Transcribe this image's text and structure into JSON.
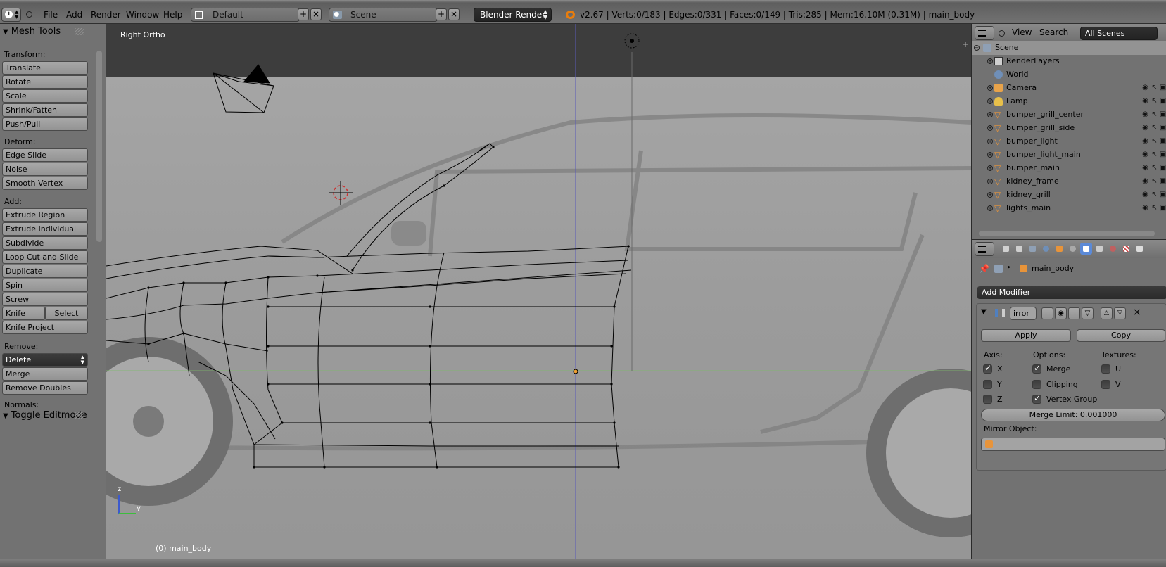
{
  "topbar": {
    "menus": [
      "File",
      "Add",
      "Render",
      "Window",
      "Help"
    ],
    "layout": "Default",
    "scene": "Scene",
    "engine": "Blender Render",
    "stats": "v2.67 | Verts:0/183 | Edges:0/331 | Faces:0/149 | Tris:285 | Mem:16.10M (0.31M) | main_body"
  },
  "toolshelf": {
    "title": "Mesh Tools",
    "transform_label": "Transform:",
    "transform": [
      "Translate",
      "Rotate",
      "Scale",
      "Shrink/Fatten",
      "Push/Pull"
    ],
    "deform_label": "Deform:",
    "deform": [
      "Edge Slide",
      "Noise",
      "Smooth Vertex"
    ],
    "add_label": "Add:",
    "add": [
      "Extrude Region",
      "Extrude Individual",
      "Subdivide",
      "Loop Cut and Slide",
      "Duplicate",
      "Spin",
      "Screw"
    ],
    "knife": "Knife",
    "select": "Select",
    "knife_project": "Knife Project",
    "remove_label": "Remove:",
    "delete": "Delete",
    "remove": [
      "Merge",
      "Remove Doubles"
    ],
    "normals_label": "Normals:",
    "toggle_editmode": "Toggle Editmode"
  },
  "viewport": {
    "view_name": "Right Ortho",
    "object_label": "(0) main_body",
    "axis_z": "z",
    "axis_y": "y"
  },
  "outliner": {
    "menus": [
      "View",
      "Search"
    ],
    "filter": "All Scenes",
    "rows": [
      {
        "name": "Scene",
        "icon": "scene-icon",
        "color": "#8fa0b5"
      },
      {
        "name": "RenderLayers",
        "icon": "render-layers-icon",
        "color": "#cfcfcf"
      },
      {
        "name": "World",
        "icon": "world-icon",
        "color": "#6f8fb8"
      },
      {
        "name": "Camera",
        "icon": "camera-icon",
        "color": "#e8a34a"
      },
      {
        "name": "Lamp",
        "icon": "lamp-icon",
        "color": "#e8c04a"
      },
      {
        "name": "bumper_grill_center",
        "icon": "mesh-icon",
        "color": "#e8943a"
      },
      {
        "name": "bumper_grill_side",
        "icon": "mesh-icon",
        "color": "#e8943a"
      },
      {
        "name": "bumper_light",
        "icon": "mesh-icon",
        "color": "#e8943a"
      },
      {
        "name": "bumper_light_main",
        "icon": "mesh-icon",
        "color": "#e8943a"
      },
      {
        "name": "bumper_main",
        "icon": "mesh-icon",
        "color": "#e8943a"
      },
      {
        "name": "kidney_frame",
        "icon": "mesh-icon",
        "color": "#e8943a"
      },
      {
        "name": "kidney_grill",
        "icon": "mesh-icon",
        "color": "#e8943a"
      },
      {
        "name": "lights_main",
        "icon": "mesh-icon",
        "color": "#e8943a"
      }
    ]
  },
  "properties": {
    "context_object": "main_body",
    "add_modifier": "Add Modifier",
    "modifier_name": "irror",
    "apply": "Apply",
    "copy": "Copy",
    "axis_label": "Axis:",
    "options_label": "Options:",
    "textures_label": "Textures:",
    "axis": [
      {
        "label": "X",
        "checked": true
      },
      {
        "label": "Y",
        "checked": false
      },
      {
        "label": "Z",
        "checked": false
      }
    ],
    "options": [
      {
        "label": "Merge",
        "checked": true
      },
      {
        "label": "Clipping",
        "checked": false
      },
      {
        "label": "Vertex Group",
        "checked": true
      }
    ],
    "textures": [
      {
        "label": "U",
        "checked": false
      },
      {
        "label": "V",
        "checked": false
      }
    ],
    "merge_limit": "Merge Limit: 0.001000",
    "mirror_object_label": "Mirror Object:"
  },
  "colors": {
    "active_tab": "#5b8ad8",
    "selected_object": "#e8943a"
  }
}
